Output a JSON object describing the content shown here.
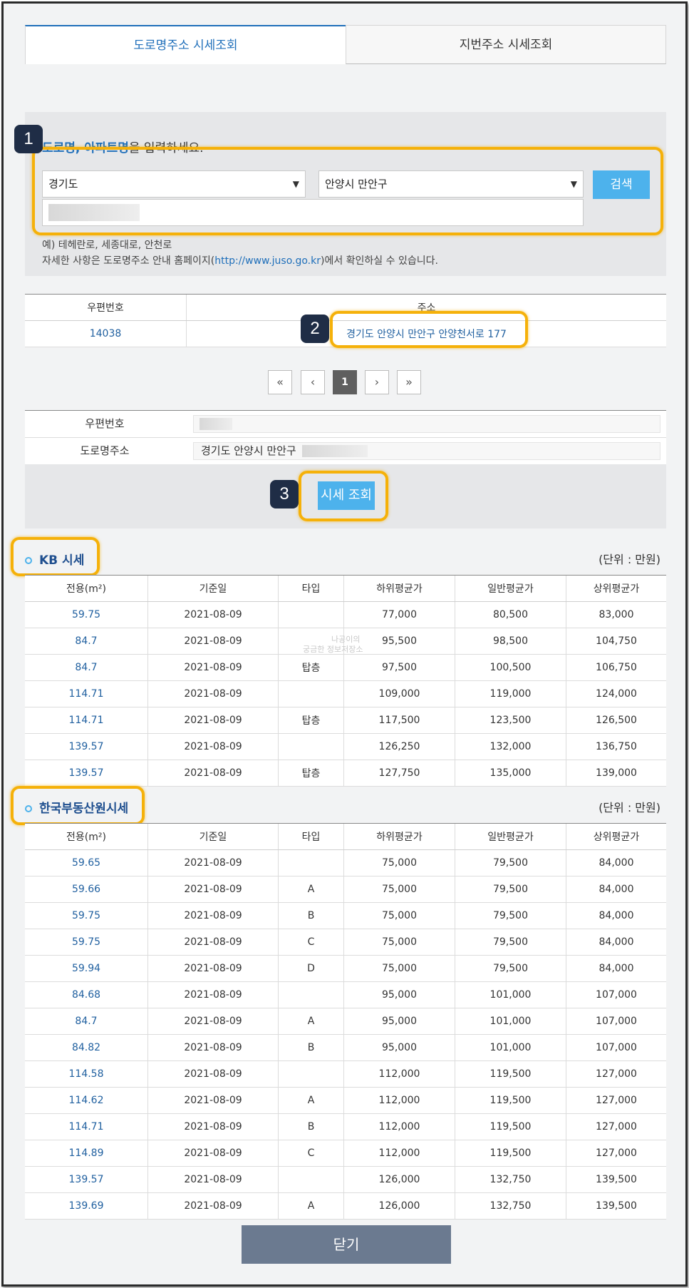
{
  "tabs": {
    "road_address": "도로명주소 시세조회",
    "lot_address": "지번주소 시세조회"
  },
  "search": {
    "prompt_highlight": "도로명, 아파트명",
    "prompt_rest": "을 입력하세요.",
    "province_value": "경기도",
    "district_value": "안양시 만안구",
    "search_button": "검색",
    "hint_example": "예) 테헤란로, 세종대로, 안천로",
    "hint_detail_prefix": "자세한 사항은 도로명주소 안내 홈페이지(",
    "hint_link": "http://www.juso.go.kr",
    "hint_detail_suffix": ")에서 확인하실 수 있습니다."
  },
  "result_table": {
    "headers": [
      "우편번호",
      "주소"
    ],
    "rows": [
      {
        "zip": "14038",
        "address": "경기도 안양시 만안구 안양천서로 177"
      }
    ]
  },
  "pagination": {
    "first": "«",
    "prev": "‹",
    "current": "1",
    "next": "›",
    "last": "»"
  },
  "detail": {
    "zip_label": "우편번호",
    "road_label": "도로명주소",
    "road_value": "경기도 안양시 만안구",
    "price_button": "시세 조회"
  },
  "annotations": {
    "step1": "1",
    "step2": "2",
    "step3": "3"
  },
  "kb": {
    "title": "KB 시세",
    "unit": "(단위 : 만원)",
    "headers": [
      "전용(m²)",
      "기준일",
      "타입",
      "하위평균가",
      "일반평균가",
      "상위평균가"
    ],
    "rows": [
      [
        "59.75",
        "2021-08-09",
        "",
        "77,000",
        "80,500",
        "83,000"
      ],
      [
        "84.7",
        "2021-08-09",
        "",
        "95,500",
        "98,500",
        "104,750"
      ],
      [
        "84.7",
        "2021-08-09",
        "탑층",
        "97,500",
        "100,500",
        "106,750"
      ],
      [
        "114.71",
        "2021-08-09",
        "",
        "109,000",
        "119,000",
        "124,000"
      ],
      [
        "114.71",
        "2021-08-09",
        "탑층",
        "117,500",
        "123,500",
        "126,500"
      ],
      [
        "139.57",
        "2021-08-09",
        "",
        "126,250",
        "132,000",
        "136,750"
      ],
      [
        "139.57",
        "2021-08-09",
        "탑층",
        "127,750",
        "135,000",
        "139,000"
      ]
    ]
  },
  "kra": {
    "title": "한국부동산원시세",
    "unit": "(단위 : 만원)",
    "headers": [
      "전용(m²)",
      "기준일",
      "타입",
      "하위평균가",
      "일반평균가",
      "상위평균가"
    ],
    "rows": [
      [
        "59.65",
        "2021-08-09",
        "",
        "75,000",
        "79,500",
        "84,000"
      ],
      [
        "59.66",
        "2021-08-09",
        "A",
        "75,000",
        "79,500",
        "84,000"
      ],
      [
        "59.75",
        "2021-08-09",
        "B",
        "75,000",
        "79,500",
        "84,000"
      ],
      [
        "59.75",
        "2021-08-09",
        "C",
        "75,000",
        "79,500",
        "84,000"
      ],
      [
        "59.94",
        "2021-08-09",
        "D",
        "75,000",
        "79,500",
        "84,000"
      ],
      [
        "84.68",
        "2021-08-09",
        "",
        "95,000",
        "101,000",
        "107,000"
      ],
      [
        "84.7",
        "2021-08-09",
        "A",
        "95,000",
        "101,000",
        "107,000"
      ],
      [
        "84.82",
        "2021-08-09",
        "B",
        "95,000",
        "101,000",
        "107,000"
      ],
      [
        "114.58",
        "2021-08-09",
        "",
        "112,000",
        "119,500",
        "127,000"
      ],
      [
        "114.62",
        "2021-08-09",
        "A",
        "112,000",
        "119,500",
        "127,000"
      ],
      [
        "114.71",
        "2021-08-09",
        "B",
        "112,000",
        "119,500",
        "127,000"
      ],
      [
        "114.89",
        "2021-08-09",
        "C",
        "112,000",
        "119,500",
        "127,000"
      ],
      [
        "139.57",
        "2021-08-09",
        "",
        "126,000",
        "132,750",
        "139,500"
      ],
      [
        "139.69",
        "2021-08-09",
        "A",
        "126,000",
        "132,750",
        "139,500"
      ]
    ]
  },
  "watermark": {
    "line1": "나공이의",
    "line2": "궁금한 정보저장소"
  },
  "close_button": "닫기",
  "colors": {
    "accent_blue": "#4db2ec",
    "link_blue": "#1f6fba",
    "highlight": "#f5b10a",
    "close_button": "#6b7a90"
  }
}
